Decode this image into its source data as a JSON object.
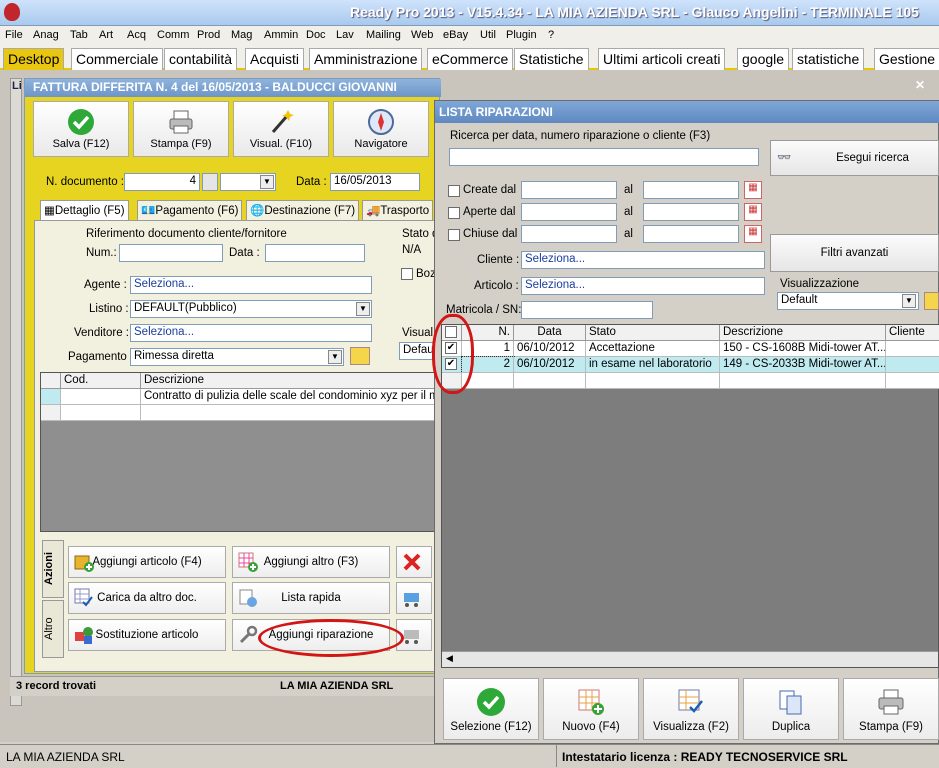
{
  "app": {
    "title": "Ready Pro 2013 - V15.4.34 - LA MIA AZIENDA SRL - Glauco Angelini - TERMINALE 105"
  },
  "menu": [
    "File",
    "Anag",
    "Tab",
    "Art",
    "Acq",
    "Comm",
    "Prod",
    "Mag",
    "Ammin",
    "Doc",
    "Lav",
    "Mailing",
    "Web",
    "eBay",
    "Util",
    "Plugin",
    "?"
  ],
  "tabs": [
    "Desktop",
    "Commerciale",
    "contabilità",
    "Acquisti",
    "Amministrazione",
    "eCommerce",
    "Statistiche",
    "Ultimi articoli creati",
    "google",
    "statistiche",
    "Gestione"
  ],
  "background": {
    "status_left": "3 record trovati",
    "status_mid": "LA MIA AZIENDA SRL",
    "side_label": "Li"
  },
  "invoice": {
    "title": "FATTURA DIFFERITA N. 4 del 16/05/2013 - BALDUCCI GIOVANNI",
    "toolbar": [
      "Salva (F12)",
      "Stampa (F9)",
      "Visual. (F10)",
      "Navigatore"
    ],
    "n_doc_label": "N. documento :",
    "n_doc_value": "4",
    "data_label": "Data :",
    "data_value": "16/05/2013",
    "subtabs": [
      "Dettaglio (F5)",
      "Pagamento (F6)",
      "Destinazione (F7)",
      "Trasporto"
    ],
    "rif_title": "Riferimento documento cliente/fornitore",
    "num_label": "Num.:",
    "data2_label": "Data :",
    "stato_label": "Stato d",
    "stato_value": "N/A",
    "boz_label": "Boz",
    "agente_label": "Agente :",
    "agente_value": "Seleziona...",
    "listino_label": "Listino :",
    "listino_value": "DEFAULT(Pubblico)",
    "venditore_label": "Venditore :",
    "venditore_value": "Seleziona...",
    "pagamento_label": "Pagamento :",
    "pagamento_value": "Rimessa diretta",
    "visual_label": "Visual",
    "visual_value": "Defau",
    "grid_headers": [
      "Cod.",
      "Descrizione"
    ],
    "grid_row": "Contratto di pulizia delle scale del condominio xyz per il mese",
    "side_tabs": [
      "Azioni",
      "Altro"
    ],
    "actions": [
      "Aggiungi articolo (F4)",
      "Aggiungi altro (F3)",
      "Carica da altro doc.",
      "Lista rapida",
      "Sostituzione articolo",
      "Aggiungi riparazione"
    ]
  },
  "riparazioni": {
    "title": "LISTA RIPARAZIONI",
    "search_label": "Ricerca per data, numero riparazione o cliente (F3)",
    "search_button": "Esegui ricerca",
    "filters_button": "Filtri avanzati",
    "create_label": "Create dal",
    "aperte_label": "Aperte dal",
    "chiuse_label": "Chiuse dal",
    "al_label": "al",
    "cliente_label": "Cliente :",
    "cliente_value": "Seleziona...",
    "articolo_label": "Articolo :",
    "articolo_value": "Seleziona...",
    "matricola_label": "Matricola / SN:",
    "visualizzazione_label": "Visualizzazione",
    "visualizzazione_value": "Default",
    "columns": [
      "N.",
      "Data",
      "Stato",
      "Descrizione",
      "Cliente"
    ],
    "rows": [
      {
        "n": "1",
        "data": "06/10/2012",
        "stato": "Accettazione",
        "descrizione": "150 - CS-1608B Midi-tower AT..."
      },
      {
        "n": "2",
        "data": "06/10/2012",
        "stato": "in esame nel laboratorio",
        "descrizione": "149 - CS-2033B Midi-tower AT..."
      }
    ],
    "buttons": [
      "Selezione (F12)",
      "Nuovo (F4)",
      "Visualizza (F2)",
      "Duplica",
      "Stampa (F9)"
    ]
  },
  "status": {
    "left": "LA MIA AZIENDA SRL",
    "right": "Intestatario licenza : READY TECNOSERVICE SRL"
  },
  "colors": {
    "accent": "#e9c711",
    "title_blue": "#6c95c8",
    "highlight_row": "#bfeaf0",
    "annotation_red": "#d21515"
  }
}
